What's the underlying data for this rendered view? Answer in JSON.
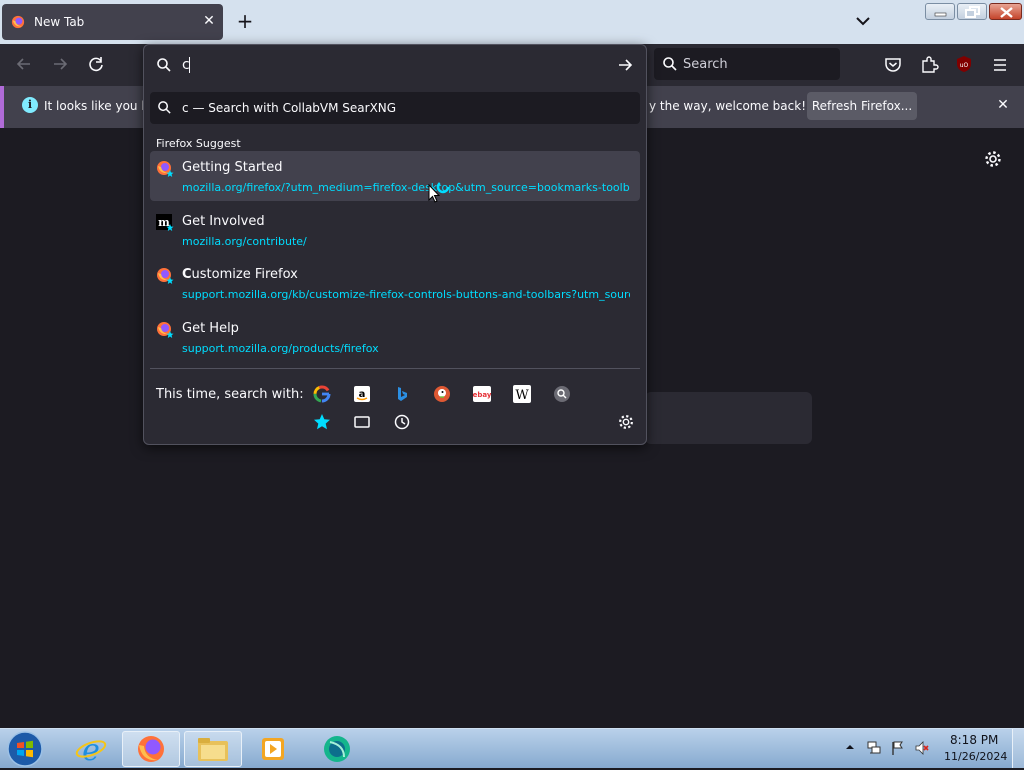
{
  "browser": {
    "tab_title": "New Tab",
    "search_placeholder": "Search"
  },
  "notification": {
    "message_left": "It looks like you ha",
    "message_right": "y the way, welcome back!",
    "button_label": "Refresh Firefox..."
  },
  "urlbar": {
    "value": "c",
    "heuristic_query": "c",
    "heuristic_text": "— Search with CollabVM SearXNG",
    "section_label": "Firefox Suggest",
    "results": [
      {
        "title": "Getting Started",
        "url": "mozilla.org/firefox/?utm_medium=firefox-desktop&utm_source=bookmarks-toolbar",
        "icon": "firefox-icon"
      },
      {
        "title": "Get Involved",
        "url": "mozilla.org/contribute/",
        "icon": "mozilla-icon"
      },
      {
        "title_bold": "C",
        "title_rest": "ustomize Firefox",
        "url": "support.mozilla.org/kb/customize-firefox-controls-buttons-and-toolbars?utm_source",
        "icon": "firefox-icon"
      },
      {
        "title": "Get Help",
        "url": "support.mozilla.org/products/firefox",
        "icon": "firefox-icon"
      }
    ],
    "oneoff_label": "This time, search with:",
    "engines": [
      "google",
      "amazon",
      "bing",
      "duckduckgo",
      "ebay",
      "wikipedia",
      "collabvm-searxng"
    ],
    "modes": [
      "bookmarks",
      "tabs",
      "history"
    ]
  },
  "taskbar": {
    "time": "8:18 PM",
    "date": "11/26/2024"
  },
  "colors": {
    "accent": "#00ddff",
    "panel_bg": "#2b2a33",
    "page_bg": "#1c1b22"
  }
}
